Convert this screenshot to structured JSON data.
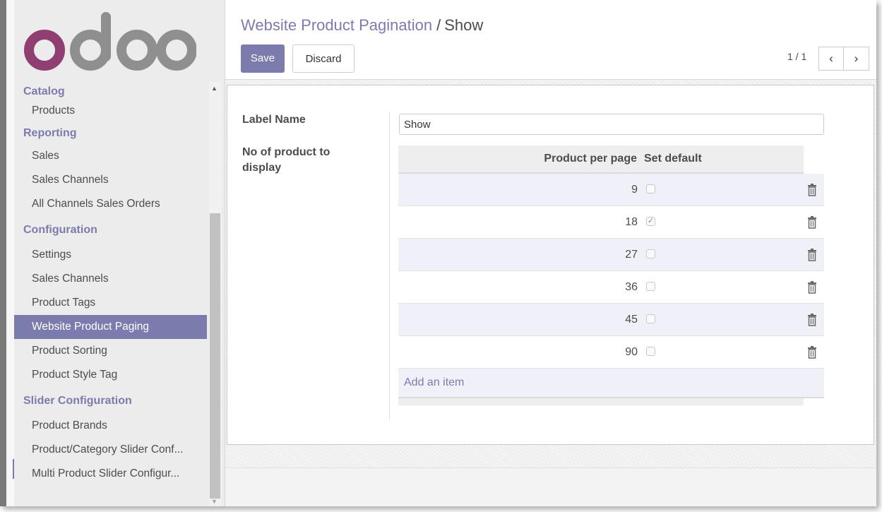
{
  "brand": {
    "logo_text": "odoo",
    "accent": "#7c7bad",
    "logo_purple": "#8f3f71",
    "logo_gray": "#8f8f8f"
  },
  "sidebar": {
    "sections": [
      {
        "title": "Catalog",
        "items": [
          "Products"
        ]
      },
      {
        "title": "Reporting",
        "items": [
          "Sales",
          "Sales Channels",
          "All Channels Sales Orders"
        ]
      },
      {
        "title": "Configuration",
        "items": [
          "Settings",
          "Sales Channels",
          "Product Tags",
          "Website Product Paging",
          "Product Sorting",
          "Product Style Tag"
        ]
      },
      {
        "title": "Slider Configuration",
        "items": [
          "Product Brands",
          "Product/Category Slider Conf...",
          "Multi Product Slider Configur..."
        ]
      }
    ],
    "active_item": "Website Product Paging"
  },
  "header": {
    "breadcrumb_parent": "Website Product Pagination",
    "breadcrumb_separator": "/",
    "breadcrumb_current": "Show",
    "save_label": "Save",
    "discard_label": "Discard",
    "pager_value": "1 / 1",
    "prev_icon": "chevron-left-icon",
    "next_icon": "chevron-right-icon"
  },
  "form": {
    "label_name_label": "Label Name",
    "label_name_value": "Show",
    "count_label": "No of product to display",
    "table": {
      "columns": [
        "Product per page",
        "Set default"
      ],
      "rows": [
        {
          "product_per_page": "9",
          "set_default": false
        },
        {
          "product_per_page": "18",
          "set_default": true
        },
        {
          "product_per_page": "27",
          "set_default": false
        },
        {
          "product_per_page": "36",
          "set_default": false
        },
        {
          "product_per_page": "45",
          "set_default": false
        },
        {
          "product_per_page": "90",
          "set_default": false
        }
      ],
      "add_label": "Add an item",
      "row_action_icon": "trash-icon"
    }
  }
}
